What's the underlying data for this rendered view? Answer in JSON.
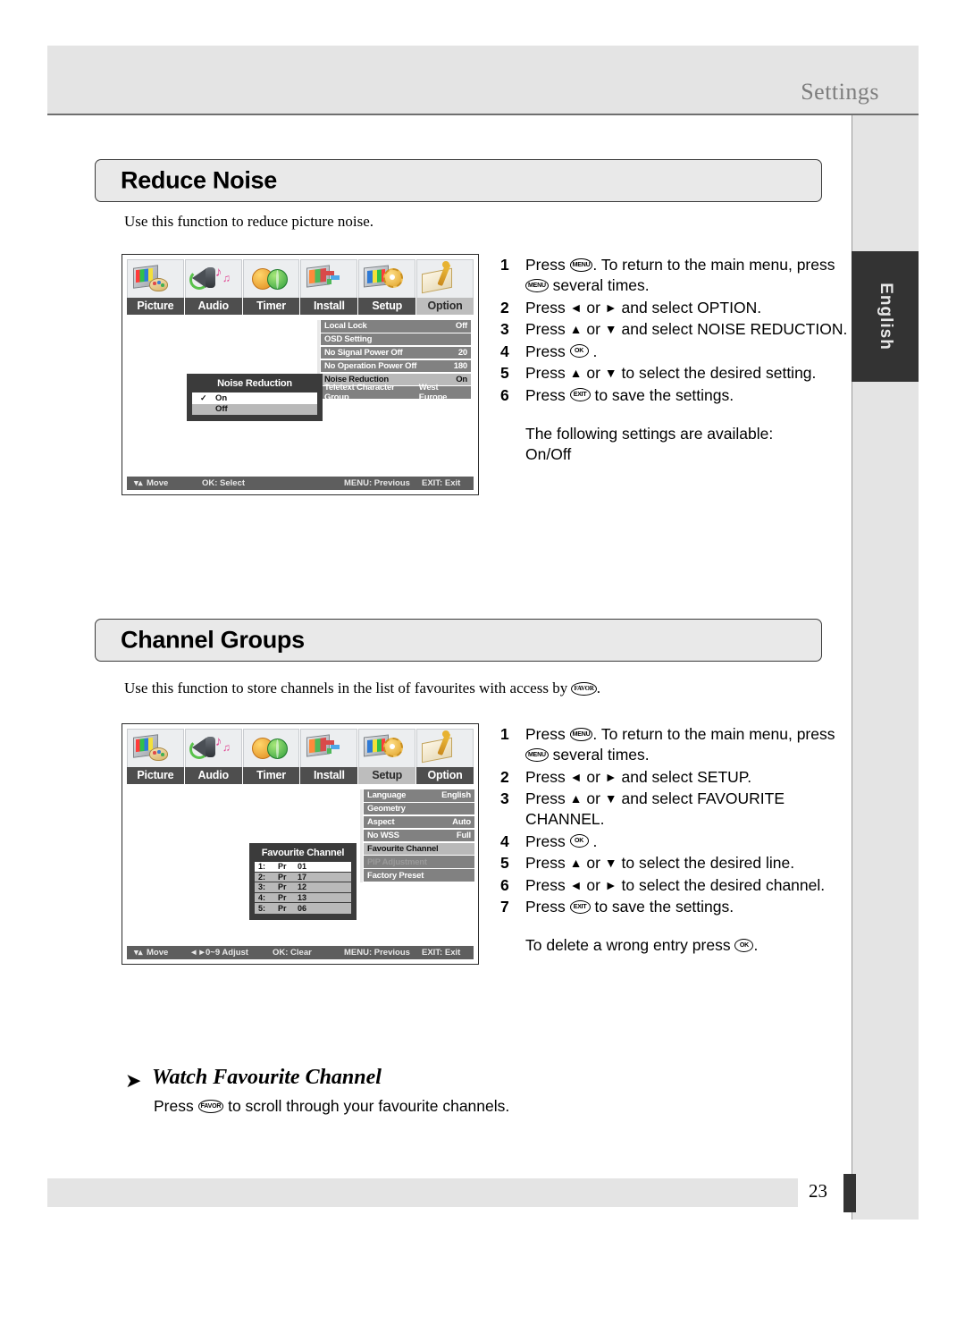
{
  "page": {
    "header_title": "Settings",
    "language_tab": "English",
    "page_number": "23"
  },
  "sections": [
    {
      "title": "Reduce Noise",
      "intro": "Use this function to reduce picture noise.",
      "steps": [
        {
          "n": "1",
          "parts": [
            "Press ",
            "MENU",
            ". To return to the main menu, press ",
            "MENU",
            " several times."
          ]
        },
        {
          "n": "2",
          "text_a": "Press ",
          "text_b": " or ",
          "text_c": " and select OPTION."
        },
        {
          "n": "3",
          "text_a": "Press ",
          "text_b": " or ",
          "text_c": " and select NOISE REDUCTION."
        },
        {
          "n": "4",
          "text_a": "Press ",
          "key": "OK",
          "text_c": " ."
        },
        {
          "n": "5",
          "text_a": "Press ",
          "text_b": " or ",
          "text_c": " to select the desired setting."
        },
        {
          "n": "6",
          "text_a": "Press ",
          "key": "EXIT",
          "text_c": " to save the settings."
        }
      ],
      "note": [
        "The following settings are available:",
        "On/Off"
      ],
      "osd": {
        "tabs": [
          {
            "label": "Picture",
            "active": false,
            "icon": "tv-palette-icon"
          },
          {
            "label": "Audio",
            "active": false,
            "icon": "speaker-note-icon"
          },
          {
            "label": "Timer",
            "active": false,
            "icon": "clock-globe-icon"
          },
          {
            "label": "Install",
            "active": false,
            "icon": "screen-plug-icon"
          },
          {
            "label": "Setup",
            "active": false,
            "icon": "monitor-gear-icon"
          },
          {
            "label": "Option",
            "active": true,
            "icon": "book-pen-icon"
          }
        ],
        "menu": [
          {
            "label": "Local Lock",
            "value": "Off",
            "state": "normal"
          },
          {
            "label": "OSD Setting",
            "value": "",
            "state": "normal"
          },
          {
            "label": "No Signal Power Off",
            "value": "20",
            "state": "normal"
          },
          {
            "label": "No Operation Power Off",
            "value": "180",
            "state": "normal"
          },
          {
            "label": "Noise Reduction",
            "value": "On",
            "state": "selected"
          },
          {
            "label": "Teletext Character Group",
            "value": "West Europe",
            "state": "normal"
          }
        ],
        "popup": {
          "title": "Noise Reduction",
          "rows": [
            {
              "label": "On",
              "checked": true,
              "highlighted": false
            },
            {
              "label": "Off",
              "checked": false,
              "highlighted": true
            }
          ]
        },
        "statusbar": {
          "move": "Move",
          "mid": "OK: Select",
          "menu": "MENU: Previous",
          "exit": "EXIT: Exit"
        }
      }
    },
    {
      "title": "Channel Groups",
      "intro_a": "Use this function to store channels in the list of favourites with access by ",
      "intro_key": "FAVOR",
      "intro_b": ".",
      "steps": [
        {
          "n": "1"
        },
        {
          "n": "2",
          "text_c": " and select SETUP."
        },
        {
          "n": "3",
          "text_c": " and select FAVOURITE",
          "cont": "CHANNEL."
        },
        {
          "n": "4",
          "key": "OK",
          "text_c": " ."
        },
        {
          "n": "5",
          "text_c": " to select the desired line."
        },
        {
          "n": "6",
          "text_c": " to select the desired channel."
        },
        {
          "n": "7",
          "key": "EXIT",
          "text_c": " to save the settings."
        }
      ],
      "note_a": "To delete a wrong entry press ",
      "note_key": "OK",
      "note_b": ".",
      "osd": {
        "tabs": [
          {
            "label": "Picture",
            "active": false,
            "icon": "tv-palette-icon"
          },
          {
            "label": "Audio",
            "active": false,
            "icon": "speaker-note-icon"
          },
          {
            "label": "Timer",
            "active": false,
            "icon": "clock-globe-icon"
          },
          {
            "label": "Install",
            "active": false,
            "icon": "screen-plug-icon"
          },
          {
            "label": "Setup",
            "active": true,
            "icon": "monitor-gear-icon"
          },
          {
            "label": "Option",
            "active": false,
            "icon": "book-pen-icon"
          }
        ],
        "menu": [
          {
            "label": "Language",
            "value": "English",
            "state": "normal"
          },
          {
            "label": "Geometry",
            "value": "",
            "state": "normal"
          },
          {
            "label": "Aspect",
            "value": "Auto",
            "state": "normal"
          },
          {
            "label": "No WSS",
            "value": "Full",
            "state": "normal"
          },
          {
            "label": "Favourite Channel",
            "value": "",
            "state": "selected"
          },
          {
            "label": "PIP Adjustment",
            "value": "",
            "state": "dim"
          },
          {
            "label": "Factory Preset",
            "value": "",
            "state": "normal"
          }
        ],
        "popup": {
          "title": "Favourite Channel",
          "rows": [
            {
              "idx": "1:",
              "pr": "Pr",
              "ch": "01",
              "highlighted": false
            },
            {
              "idx": "2:",
              "pr": "Pr",
              "ch": "17",
              "highlighted": true
            },
            {
              "idx": "3:",
              "pr": "Pr",
              "ch": "12",
              "highlighted": true
            },
            {
              "idx": "4:",
              "pr": "Pr",
              "ch": "13",
              "highlighted": true
            },
            {
              "idx": "5:",
              "pr": "Pr",
              "ch": "06",
              "highlighted": true
            }
          ]
        },
        "statusbar": {
          "move": "Move",
          "adjust": "0~9   Adjust",
          "mid": "OK: Clear",
          "menu": "MENU: Previous",
          "exit": "EXIT: Exit"
        }
      }
    }
  ],
  "subsection": {
    "heading": "Watch Favourite Channel",
    "text_a": "Press ",
    "key": "FAVOR",
    "text_b": " to scroll through your favourite channels."
  },
  "steps_common": {
    "press": "Press ",
    "or": " or ",
    "s1_a": "Press ",
    "s1_b": ". To return to the main menu, press ",
    "s1_c": " several times.",
    "key_menu": "MENU",
    "key_ok": "OK",
    "key_exit": "EXIT"
  }
}
